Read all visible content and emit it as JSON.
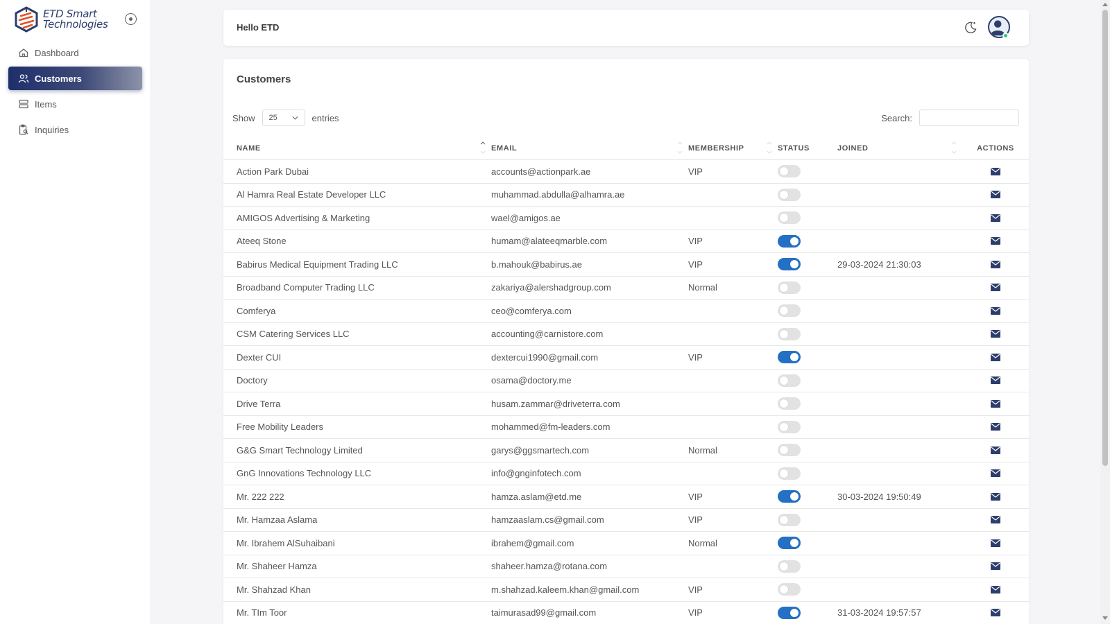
{
  "brand": {
    "line1": "ETD Smart",
    "line2": "Technologies"
  },
  "sidebar": {
    "items": [
      {
        "label": "Dashboard",
        "icon": "home-icon",
        "active": false
      },
      {
        "label": "Customers",
        "icon": "users-icon",
        "active": true
      },
      {
        "label": "Items",
        "icon": "server-icon",
        "active": false
      },
      {
        "label": "Inquiries",
        "icon": "clipboard-search-icon",
        "active": false
      }
    ]
  },
  "header": {
    "greeting": "Hello ETD"
  },
  "main": {
    "title": "Customers",
    "show_label": "Show",
    "entries_value": "25",
    "entries_label": "entries",
    "search_label": "Search:",
    "search_value": "",
    "columns": {
      "name": "NAME",
      "email": "EMAIL",
      "membership": "MEMBERSHIP",
      "status": "STATUS",
      "joined": "JOINED",
      "actions": "ACTIONS"
    },
    "rows": [
      {
        "name": "Action Park Dubai",
        "email": "accounts@actionpark.ae",
        "membership": "VIP",
        "status": false,
        "joined": ""
      },
      {
        "name": "Al Hamra Real Estate Developer LLC",
        "email": "muhammad.abdulla@alhamra.ae",
        "membership": "",
        "status": false,
        "joined": ""
      },
      {
        "name": "AMIGOS Advertising & Marketing",
        "email": "wael@amigos.ae",
        "membership": "",
        "status": false,
        "joined": ""
      },
      {
        "name": "Ateeq Stone",
        "email": "humam@alateeqmarble.com",
        "membership": "VIP",
        "status": true,
        "joined": ""
      },
      {
        "name": "Babirus Medical Equipment Trading LLC",
        "email": "b.mahouk@babirus.ae",
        "membership": "VIP",
        "status": true,
        "joined": "29-03-2024 21:30:03"
      },
      {
        "name": "Broadband Computer Trading LLC",
        "email": "zakariya@alershadgroup.com",
        "membership": "Normal",
        "status": false,
        "joined": ""
      },
      {
        "name": "Comferya",
        "email": "ceo@comferya.com",
        "membership": "",
        "status": false,
        "joined": ""
      },
      {
        "name": "CSM Catering Services LLC",
        "email": "accounting@carnistore.com",
        "membership": "",
        "status": false,
        "joined": ""
      },
      {
        "name": "Dexter CUI",
        "email": "dextercui1990@gmail.com",
        "membership": "VIP",
        "status": true,
        "joined": ""
      },
      {
        "name": "Doctory",
        "email": "osama@doctory.me",
        "membership": "",
        "status": false,
        "joined": ""
      },
      {
        "name": "Drive Terra",
        "email": "husam.zammar@driveterra.com",
        "membership": "",
        "status": false,
        "joined": ""
      },
      {
        "name": "Free Mobility Leaders",
        "email": "mohammed@fm-leaders.com",
        "membership": "",
        "status": false,
        "joined": ""
      },
      {
        "name": "G&G Smart Technology Limited",
        "email": "garys@ggsmartech.com",
        "membership": "Normal",
        "status": false,
        "joined": ""
      },
      {
        "name": "GnG Innovations Technology LLC",
        "email": "info@gnginfotech.com",
        "membership": "",
        "status": false,
        "joined": ""
      },
      {
        "name": "Mr. 222 222",
        "email": "hamza.aslam@etd.me",
        "membership": "VIP",
        "status": true,
        "joined": "30-03-2024 19:50:49"
      },
      {
        "name": "Mr. Hamzaa Aslama",
        "email": "hamzaaslam.cs@gmail.com",
        "membership": "VIP",
        "status": false,
        "joined": ""
      },
      {
        "name": "Mr. Ibrahem AlSuhaibani",
        "email": "ibrahem@gmail.com",
        "membership": "Normal",
        "status": true,
        "joined": ""
      },
      {
        "name": "Mr. Shaheer Hamza",
        "email": "shaheer.hamza@rotana.com",
        "membership": "",
        "status": false,
        "joined": ""
      },
      {
        "name": "Mr. Shahzad Khan",
        "email": "m.shahzad.kaleem.khan@gmail.com",
        "membership": "VIP",
        "status": false,
        "joined": ""
      },
      {
        "name": "Mr. TIm Toor",
        "email": "taimurasad99@gmail.com",
        "membership": "VIP",
        "status": true,
        "joined": "31-03-2024 19:57:57"
      }
    ]
  },
  "colors": {
    "accent": "#2370c4",
    "nav_active": "#1f2f6b",
    "online": "#2ecc71"
  }
}
